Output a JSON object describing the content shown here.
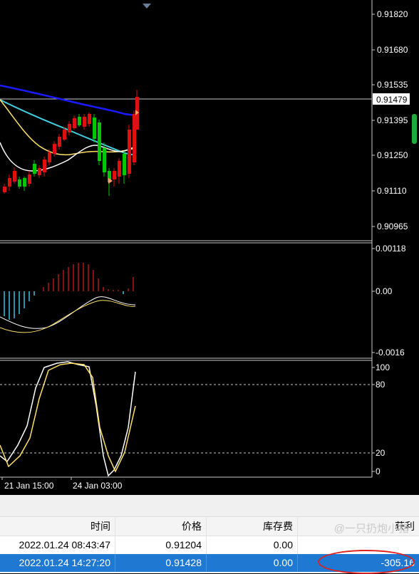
{
  "price_axis": {
    "labels": [
      "0.91820",
      "0.91680",
      "0.91535",
      "0.91395",
      "0.91250",
      "0.91110",
      "0.90965"
    ],
    "current_price": "0.91479"
  },
  "macd_axis": {
    "labels": [
      "0.00118",
      "0.00",
      "-0.0016"
    ]
  },
  "stoch_axis": {
    "labels": [
      "100",
      "80",
      "20",
      "0"
    ]
  },
  "time_axis": {
    "labels": [
      "21 Jan 15:00",
      "24 Jan 03:00"
    ]
  },
  "colors": {
    "bull": "#00c800",
    "bear": "#e01010",
    "ma_slow": "#1a1aff",
    "ma_mid": "#40d0e0",
    "ma_fast": "#ffe066",
    "ma_white": "#ffffff",
    "macd_pos": "#b01818",
    "macd_neg": "#40c0e0",
    "selection": "#1f78d1",
    "annotation": "#e0201a"
  },
  "table": {
    "headers": [
      "时间",
      "价格",
      "库存费",
      "获利"
    ],
    "rows": [
      [
        "2022.01.24 08:43:47",
        "0.91204",
        "0.00",
        ""
      ],
      [
        "2022.01.24 14:27:20",
        "0.91428",
        "0.00",
        "-305.16"
      ]
    ],
    "watermark": "@一只扔炮小猪"
  }
}
